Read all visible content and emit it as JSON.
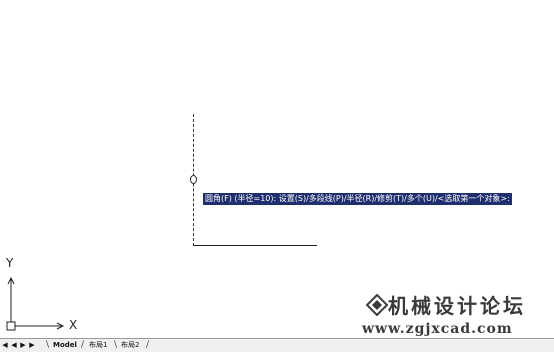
{
  "command_prompt": "圆角(F) (半径=10): 设置(S)/多段线(P)/半径(R)/修剪(T)/多个(U)/<选取第一个对象>:",
  "ucs": {
    "x_label": "X",
    "y_label": "Y"
  },
  "watermark": {
    "title": "机械设计论坛",
    "url": "www.zgjxcad.com"
  },
  "layout_tabs": {
    "nav_buttons": [
      "first",
      "previous",
      "next",
      "last"
    ],
    "tabs": [
      "Model",
      "布局1",
      "布局2"
    ],
    "active_tab": "Model"
  },
  "colors": {
    "prompt_bg": "#1f2f6e",
    "prompt_text": "#ffffff",
    "canvas_bg": "#ffffff"
  }
}
